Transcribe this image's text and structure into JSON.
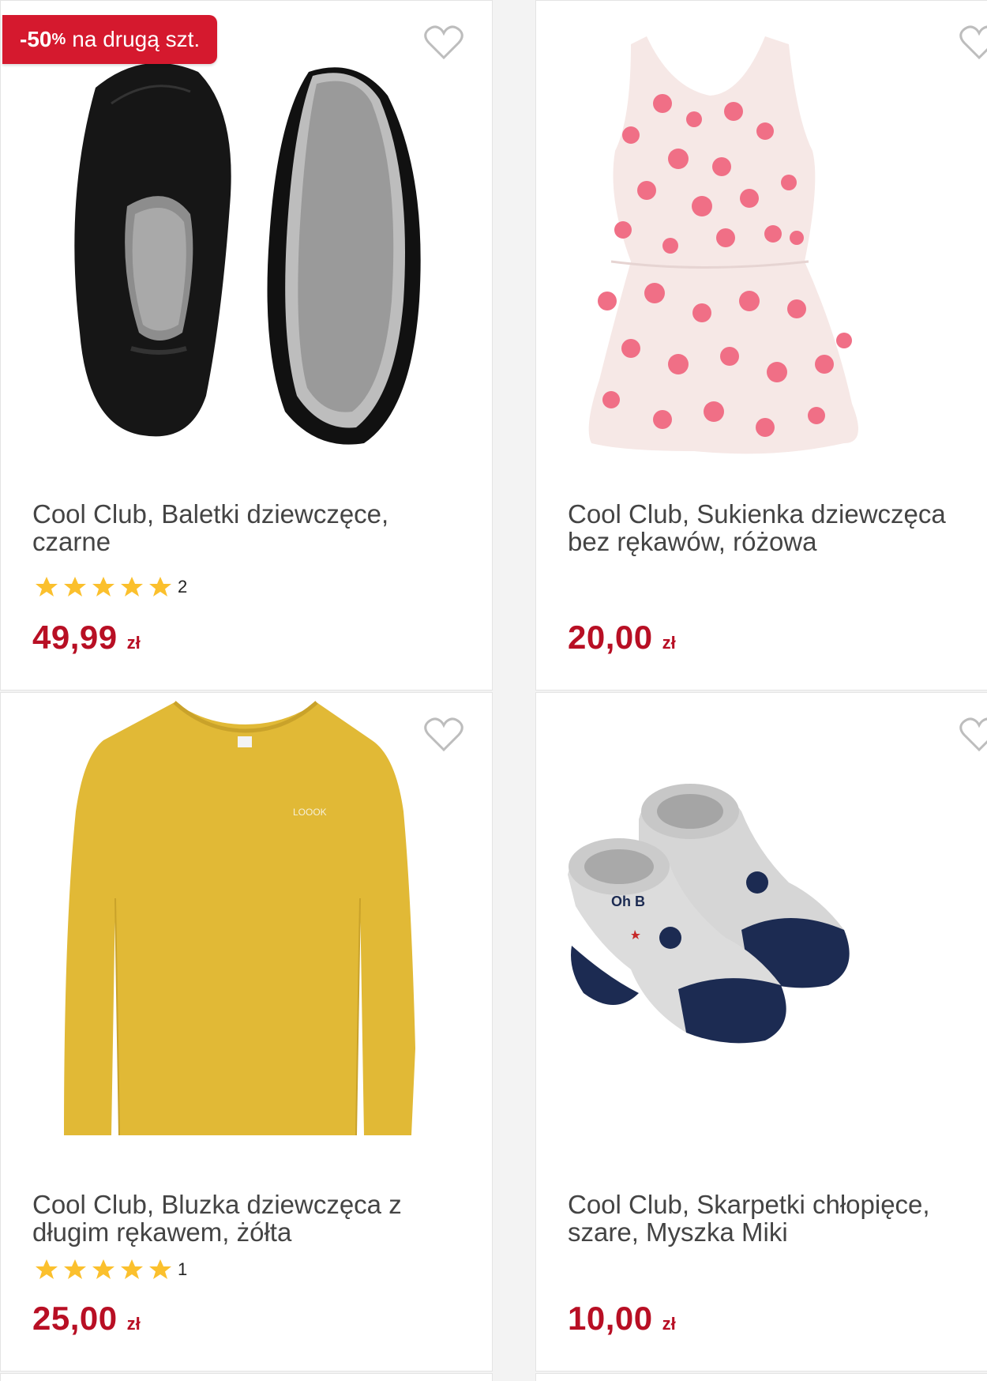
{
  "products": [
    {
      "title": "Cool Club, Baletki dziewczęce, czarne",
      "badge": {
        "strong": "-50",
        "pct": "%",
        "text": "na drugą szt."
      },
      "rating_count": "2",
      "rating_stars": 5,
      "price": "49,99",
      "currency": "zł",
      "image_icon": "ballet-flats-image"
    },
    {
      "title": "Cool Club, Sukienka dziewczęca bez rękawów, różowa",
      "price": "20,00",
      "currency": "zł",
      "image_icon": "polka-dot-dress-image"
    },
    {
      "title": "Cool Club, Bluzka dziewczęca z długim rękawem, żółta",
      "rating_count": "1",
      "rating_stars": 5,
      "price": "25,00",
      "currency": "zł",
      "image_icon": "yellow-blouse-image"
    },
    {
      "title": "Cool Club, Skarpetki chłopięce, szare, Myszka Miki",
      "price": "10,00",
      "currency": "zł",
      "image_icon": "baby-socks-image"
    }
  ],
  "colors": {
    "price": "#b80f24",
    "badge": "#d5192e",
    "star": "#fbc02d",
    "heart_outline": "#bdbdbd"
  }
}
